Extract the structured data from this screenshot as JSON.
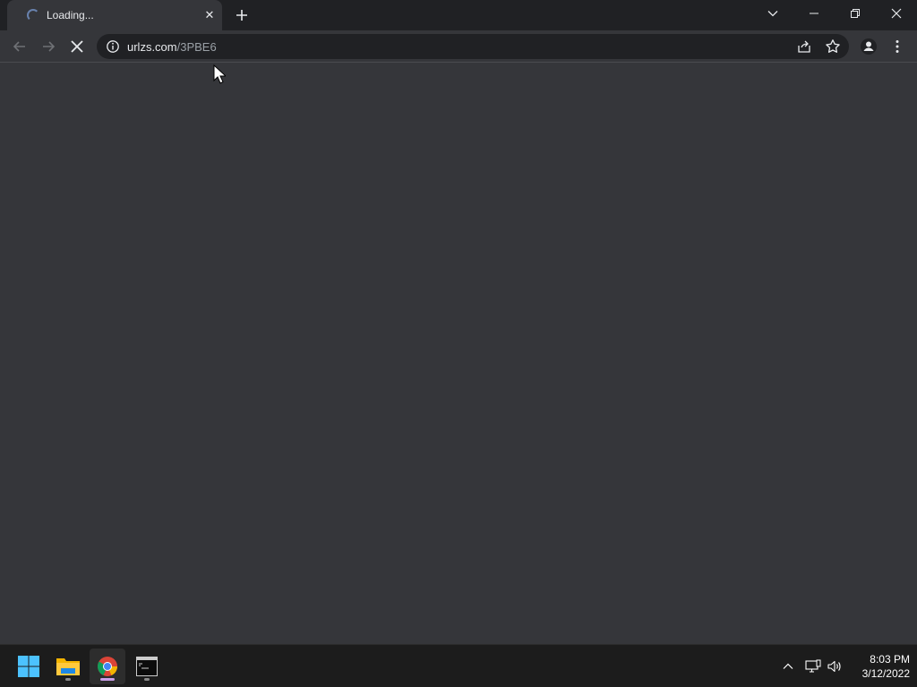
{
  "browser": {
    "tab": {
      "title": "Loading...",
      "close_label": "✕"
    },
    "new_tab_label": "+",
    "omnibox": {
      "host": "urlzs.com",
      "path": "/3PBE6"
    },
    "window_controls": [
      "tab-search",
      "minimize",
      "restore",
      "close"
    ]
  },
  "taskbar": {
    "apps": [
      {
        "name": "start",
        "icon": "windows-icon"
      },
      {
        "name": "file-explorer",
        "icon": "folder-icon"
      },
      {
        "name": "chrome",
        "icon": "chrome-icon",
        "active": true
      },
      {
        "name": "command-prompt",
        "icon": "terminal-icon"
      }
    ],
    "clock": {
      "time": "8:03 PM",
      "date": "3/12/2022"
    }
  },
  "colors": {
    "tabstrip": "#202124",
    "toolbar": "#35363a",
    "omnibox": "#202124",
    "taskbar": "#1c1c1c",
    "accent_indicator": "#c99ee8"
  }
}
